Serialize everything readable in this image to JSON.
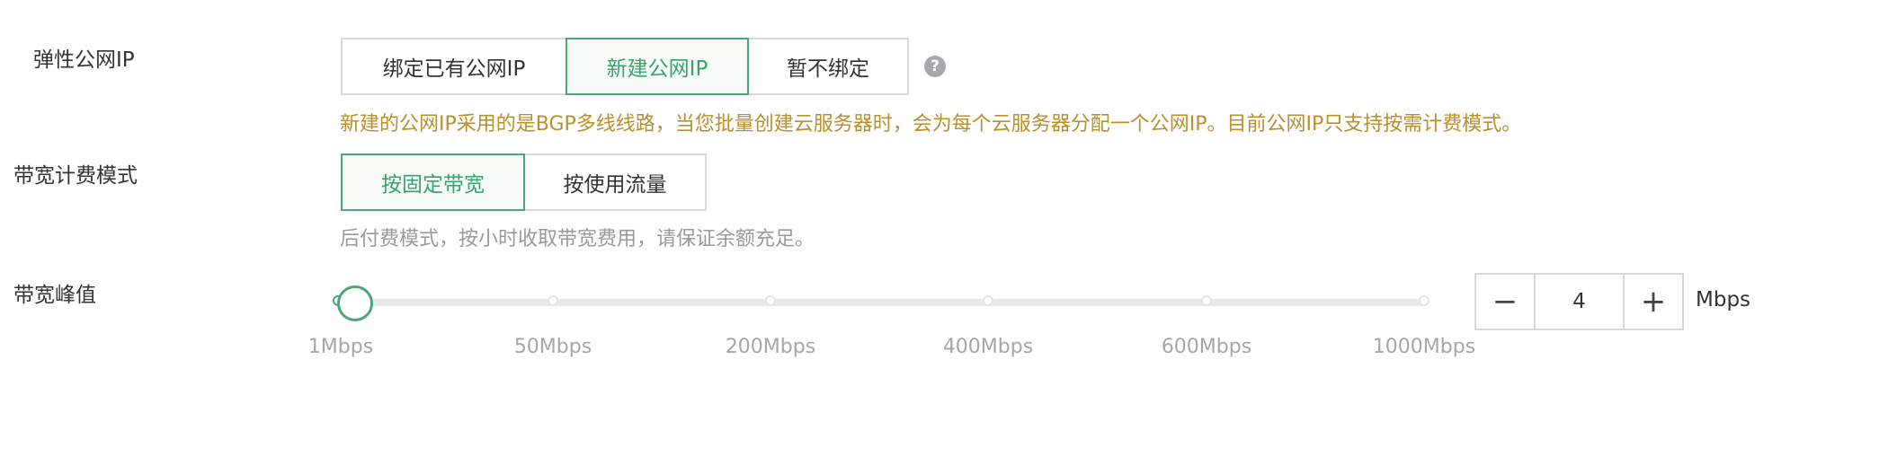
{
  "eip": {
    "label": "弹性公网IP",
    "options": [
      "绑定已有公网IP",
      "新建公网IP",
      "暂不绑定"
    ],
    "selected_index": 1,
    "help_icon": "question-circle-icon",
    "help_glyph": "?",
    "notice": "新建的公网IP采用的是BGP多线线路，当您批量创建云服务器时，会为每个云服务器分配一个公网IP。目前公网IP只支持按需计费模式。"
  },
  "billing": {
    "label": "带宽计费模式",
    "options": [
      "按固定带宽",
      "按使用流量"
    ],
    "selected_index": 0,
    "hint": "后付费模式，按小时收取带宽费用，请保证余额充足。"
  },
  "bandwidth": {
    "label": "带宽峰值",
    "scale_labels": [
      "1Mbps",
      "50Mbps",
      "200Mbps",
      "400Mbps",
      "600Mbps",
      "1000Mbps"
    ],
    "value": "4",
    "decrement_glyph": "−",
    "increment_glyph": "+",
    "unit": "Mbps"
  },
  "colors": {
    "accent": "#4aa878",
    "notice": "#b8902c",
    "hint": "#9a9a9a"
  }
}
